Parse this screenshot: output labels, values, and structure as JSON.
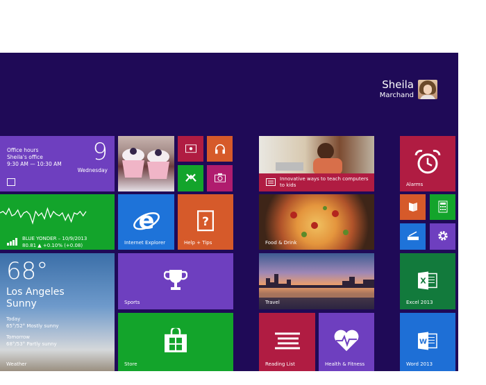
{
  "user": {
    "first_name": "Sheila",
    "last_name": "Marchand"
  },
  "colors": {
    "background": "#1f0a57",
    "purple": "#6e3fbf",
    "green": "#13a42b",
    "blue": "#1e73d9",
    "orange": "#d65a2a",
    "crimson": "#b01c42",
    "excel_green": "#127a3c",
    "word_blue": "#1e6fd6"
  },
  "tiles": {
    "calendar": {
      "line1": "Office hours",
      "line2": "Sheila's office",
      "line3": "9:30 AM — 10:30 AM",
      "date": "9",
      "day": "Wednesday",
      "icon": "calendar-icon"
    },
    "finance": {
      "line1": "BLUE YONDER – 10/9/2013",
      "line2": "80.81 ▲ +0.10% (+0.08)",
      "trend": [
        0.55,
        0.6,
        0.5,
        0.7,
        0.45,
        0.5,
        0.65,
        0.4,
        0.55,
        0.6,
        0.5,
        0.2,
        0.6,
        0.45,
        0.55,
        0.35,
        0.7,
        0.4,
        0.6,
        0.5,
        0.45,
        0.55,
        0.3,
        0.5,
        0.25,
        0.55,
        0.5,
        0.6,
        0.45,
        0.6
      ]
    },
    "weather": {
      "temp": "68°",
      "city": "Los Angeles",
      "condition": "Sunny",
      "today_label": "Today",
      "today": "65°/52° Mostly sunny",
      "tomorrow_label": "Tomorrow",
      "tomorrow": "68°/53° Partly sunny",
      "label": "Weather"
    },
    "photos": {
      "icon": "cupcake-photo"
    },
    "video": {
      "icon": "video-icon"
    },
    "music": {
      "icon": "headphones-icon"
    },
    "games": {
      "icon": "xbox-icon"
    },
    "camera": {
      "icon": "camera-icon"
    },
    "ie": {
      "label": "Internet Explorer",
      "icon": "ie-icon"
    },
    "help": {
      "label": "Help + Tips",
      "icon": "help-icon"
    },
    "sports": {
      "label": "Sports",
      "icon": "trophy-icon"
    },
    "store": {
      "label": "Store",
      "icon": "store-icon"
    },
    "news": {
      "headline": "Innovative ways to teach computers to kids",
      "icon": "news-icon"
    },
    "food": {
      "label": "Food & Drink"
    },
    "travel": {
      "label": "Travel"
    },
    "reading": {
      "label": "Reading List",
      "icon": "reading-list-icon"
    },
    "health": {
      "label": "Health & Fitness",
      "icon": "heart-icon"
    },
    "alarms": {
      "label": "Alarms",
      "icon": "alarm-icon"
    },
    "small1": {
      "icon": "book-icon"
    },
    "calculator": {
      "icon": "calculator-icon"
    },
    "scanner": {
      "icon": "scanner-icon"
    },
    "settings": {
      "icon": "gear-icon"
    },
    "excel": {
      "label": "Excel 2013",
      "glyph": "X"
    },
    "word": {
      "label": "Word 2013",
      "glyph": "W"
    }
  }
}
